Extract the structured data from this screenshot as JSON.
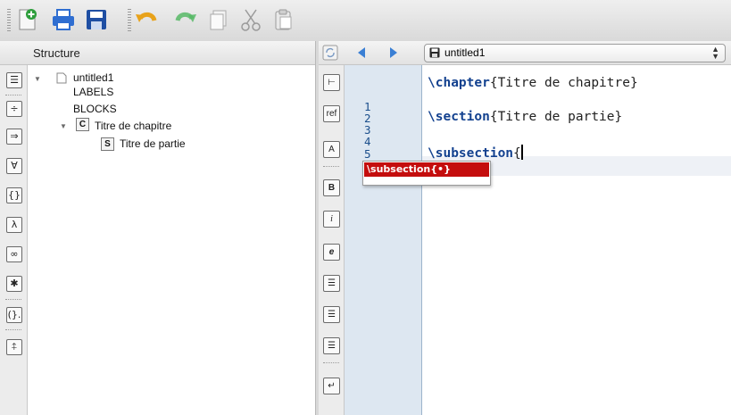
{
  "toolbar": {
    "buttons": [
      {
        "icon": "new-document-icon"
      },
      {
        "icon": "print-icon"
      },
      {
        "icon": "save-icon"
      },
      {
        "icon": "undo-icon"
      },
      {
        "icon": "redo-icon"
      },
      {
        "icon": "copy-icon"
      },
      {
        "icon": "cut-icon"
      },
      {
        "icon": "paste-icon"
      }
    ]
  },
  "structure": {
    "title": "Structure",
    "tree": {
      "root": "untitled1",
      "labels": "LABELS",
      "blocks": "BLOCKS",
      "chapter": {
        "badge": "C",
        "label": "Titre de chapitre"
      },
      "section": {
        "badge": "S",
        "label": "Titre de partie"
      }
    },
    "toolbar_glyphs": [
      "☰",
      "÷",
      "⇒",
      "∀",
      "{}",
      "λ",
      "∞",
      "✱",
      "(}.",
      "⍏"
    ]
  },
  "editor": {
    "document": "untitled1",
    "toolbar_glyphs": [
      "⊢",
      "ref",
      "A",
      "B",
      "i",
      "e",
      "☰",
      "☰",
      "☰",
      "↵"
    ],
    "line_numbers": [
      "1",
      "2",
      "3",
      "4",
      "5"
    ],
    "lines": [
      {
        "cmd": "\\chapter",
        "arg": "{Titre de chapitre}"
      },
      {
        "cmd": "",
        "arg": ""
      },
      {
        "cmd": "\\section",
        "arg": "{Titre de partie}"
      },
      {
        "cmd": "",
        "arg": ""
      },
      {
        "cmd": "\\subsection",
        "arg": "{"
      }
    ],
    "completion": "\\subsection{•}"
  },
  "colors": {
    "keyword": "#13418f",
    "completion_highlight": "#c40d0d",
    "gutter": "#dde7f1"
  }
}
